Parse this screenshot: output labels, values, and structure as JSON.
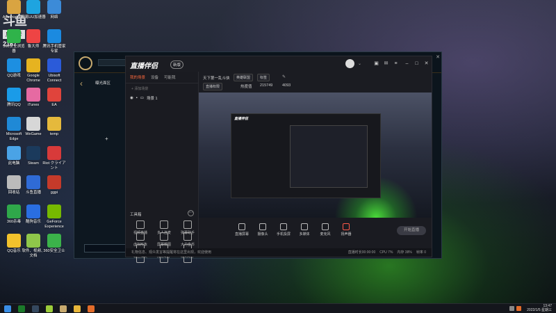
{
  "watermark": {
    "logo": "斗鱼",
    "room_label": "房间号",
    "room_number": "2167"
  },
  "desktop_icons": [
    {
      "label": "Administrator",
      "color": "#d9a441"
    },
    {
      "label": "网易UU加速器",
      "color": "#1ea4e0"
    },
    {
      "label": "网络",
      "color": "#3c8bd8"
    },
    {
      "label": "360安全浏览器",
      "color": "#2fb34a"
    },
    {
      "label": "鲁大师",
      "color": "#e44"
    },
    {
      "label": "腾讯手机管家专家",
      "color": "#1b8ae0"
    },
    {
      "label": "QQ游戏",
      "color": "#1d8fe1"
    },
    {
      "label": "Google Chrome",
      "color": "#e6b320"
    },
    {
      "label": "Ubisoft Connect",
      "color": "#2b5bd9"
    },
    {
      "label": "腾讯QQ",
      "color": "#1a9be8"
    },
    {
      "label": "iTunes",
      "color": "#e66aa2"
    },
    {
      "label": "EA",
      "color": "#e0443c"
    },
    {
      "label": "Microsoft Edge",
      "color": "#1f89d6"
    },
    {
      "label": "WeGame",
      "color": "#d7d7d7"
    },
    {
      "label": "temp",
      "color": "#e5b93c"
    },
    {
      "label": "此电脑",
      "color": "#4aa3e6"
    },
    {
      "label": "Steam",
      "color": "#1b3a5c"
    },
    {
      "label": "Riot クライアント",
      "color": "#d83a3a"
    },
    {
      "label": "回收站",
      "color": "#bbbbbb"
    },
    {
      "label": "斗鱼直播",
      "color": "#2f6bd6"
    },
    {
      "label": "ggpi",
      "color": "#c43a2a"
    },
    {
      "label": "360杀毒",
      "color": "#2fa84a"
    },
    {
      "label": "酷狗音乐",
      "color": "#2a6ee0"
    },
    {
      "label": "GeForce Experience",
      "color": "#76b900"
    },
    {
      "label": "QQ音乐",
      "color": "#f2c22c"
    },
    {
      "label": "软件、视频、文档",
      "color": "#8fc64a"
    },
    {
      "label": "360安全卫士",
      "color": "#3bb24a"
    }
  ],
  "game_client": {
    "search_placeholder": "",
    "left_label": "曝光面区"
  },
  "app": {
    "brand": "直播伴侣",
    "badge": "新版",
    "tabs": [
      "我的场景",
      "设备",
      "可能我"
    ],
    "scene_add": "添加场景",
    "scene_name": "场景 1",
    "tools_header": "工具箱",
    "tools": [
      {
        "label": "视频直播"
      },
      {
        "label": "多人连麦"
      },
      {
        "label": "弹幕助手"
      },
      {
        "label": "虚拟形象"
      },
      {
        "label": "屏幕截图"
      },
      {
        "label": "大力金币"
      },
      {
        "label": "粉丝抽奖"
      },
      {
        "label": "房管助手"
      },
      {
        "label": "歌词助手"
      },
      {
        "label": "礼物特效"
      },
      {
        "label": "表情"
      },
      {
        "label": "福利"
      }
    ],
    "header": {
      "title": "天下第一乱斗侠",
      "category": "英雄联盟",
      "edit": "标签",
      "viewers_label": "热度值",
      "viewers": "215749",
      "fans": "4093",
      "room_tag": "直播权限"
    },
    "actions": [
      {
        "label": "直播屏幕"
      },
      {
        "label": "摄像头"
      },
      {
        "label": "手机投屏"
      },
      {
        "label": "多媒体"
      },
      {
        "label": "麦克风"
      },
      {
        "label": "扬声器"
      }
    ],
    "start_button": "开始直播",
    "status_text": "礼物信息、观众发言等提醒将在这里出现，欢迎使用",
    "stats": [
      "直播时长00:00:00",
      "CPU 7%",
      "内存 38%",
      "帧率 0"
    ]
  },
  "taskbar": {
    "time": "13:47",
    "date": "2022/1/5 星期三"
  }
}
